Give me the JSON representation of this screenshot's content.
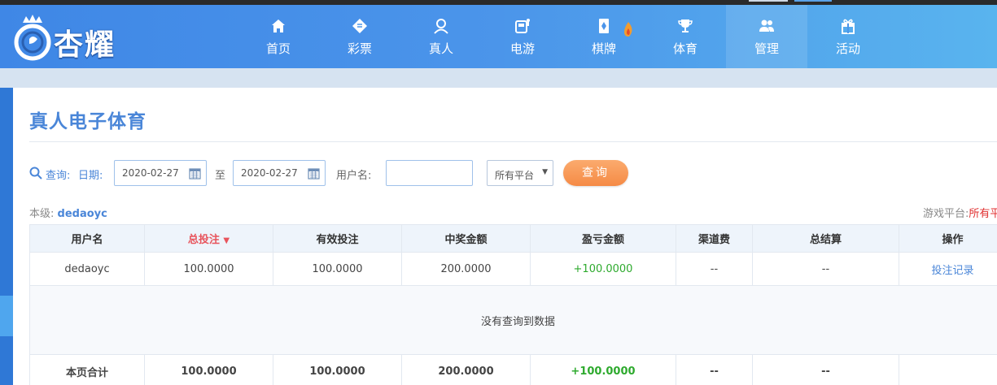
{
  "brand": {
    "name": "杏耀"
  },
  "nav": [
    {
      "label": "首页",
      "icon": "home-icon"
    },
    {
      "label": "彩票",
      "icon": "lottery-ticket-icon"
    },
    {
      "label": "真人",
      "icon": "person-icon"
    },
    {
      "label": "电游",
      "icon": "slot-machine-icon"
    },
    {
      "label": "棋牌",
      "icon": "playing-card-icon"
    },
    {
      "label": "体育",
      "icon": "trophy-icon"
    },
    {
      "label": "管理",
      "icon": "users-icon"
    },
    {
      "label": "活动",
      "icon": "gift-icon"
    }
  ],
  "page": {
    "title": "真人电子体育"
  },
  "search": {
    "query_label": "查询:",
    "date_label": "日期:",
    "date_from": "2020-02-27",
    "to_label": "至",
    "date_to": "2020-02-27",
    "username_label": "用户名:",
    "username_value": "",
    "platform_selected": "所有平台",
    "submit_label": "查询"
  },
  "level": {
    "label": "本级:",
    "username": "dedaoyc"
  },
  "platform_info": {
    "label": "游戏平台:",
    "value": "所有平"
  },
  "table": {
    "headers": [
      "用户名",
      "总投注",
      "有效投注",
      "中奖金额",
      "盈亏金额",
      "渠道费",
      "总结算",
      "操作"
    ],
    "sort_indicator": "▼",
    "row": {
      "username": "dedaoyc",
      "total_bet": "100.0000",
      "valid_bet": "100.0000",
      "winnings": "200.0000",
      "profit_loss": "+100.0000",
      "channel_fee": "--",
      "total_settlement": "--",
      "action": "投注记录"
    },
    "empty_message": "没有查询到数据",
    "summary": {
      "label": "本页合计",
      "total_bet": "100.0000",
      "valid_bet": "100.0000",
      "winnings": "200.0000",
      "profit_loss": "+100.0000",
      "channel_fee": "--",
      "total_settlement": "--"
    }
  },
  "colors": {
    "header_gradient_start": "#3f87e6",
    "header_gradient_end": "#59b4ee",
    "accent_blue": "#4a86d8",
    "profit_green": "#2eaa2e",
    "sort_red": "#e8545c",
    "button_orange": "#f58a45"
  }
}
